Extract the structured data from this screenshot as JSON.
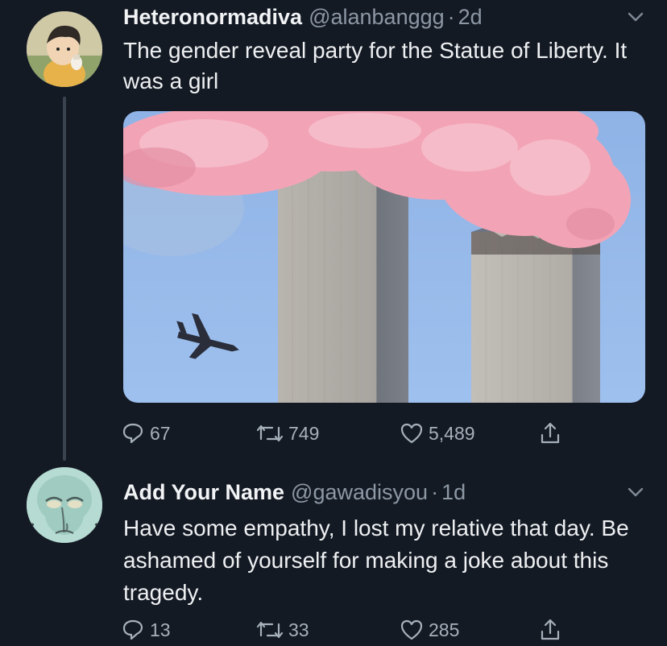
{
  "tweets": [
    {
      "name": "Heteronormadiva",
      "handle": "@alanbanggg",
      "separator": "·",
      "time": "2d",
      "text": "The gender reveal party for the Statue of Liberty. It was a girl",
      "stats": {
        "replies": "67",
        "retweets": "749",
        "likes": "5,489"
      }
    },
    {
      "name": "Add Your Name",
      "handle": "@gawadisyou",
      "separator": "·",
      "time": "1d",
      "text": "Have some empathy, I lost my relative that day.  Be ashamed of yourself for making a joke about this tragedy.",
      "stats": {
        "replies": "13",
        "retweets": "33",
        "likes": "285"
      }
    }
  ],
  "icons": {
    "reply": "reply-icon",
    "retweet": "retweet-icon",
    "like": "heart-icon",
    "share": "share-icon",
    "more": "chevron-down-icon"
  },
  "colors": {
    "background": "#141a24",
    "muted": "#8d98a5",
    "text": "#eef0f2"
  }
}
